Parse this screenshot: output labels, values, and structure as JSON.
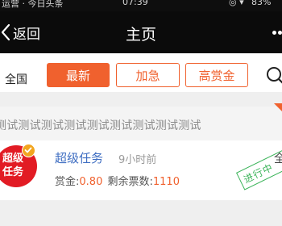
{
  "status_bar": {
    "left": "运营 · 今日头条",
    "time": "07:39",
    "battery": "83%"
  },
  "nav": {
    "back_label": "返回",
    "title": "主页"
  },
  "filter": {
    "region": "全国",
    "chips": [
      {
        "label": "最新",
        "active": true
      },
      {
        "label": "加急",
        "active": false
      },
      {
        "label": "高赏金",
        "active": false
      }
    ]
  },
  "marquee": {
    "text": "测试测试测试测试测试测试测试测试测试"
  },
  "task": {
    "badge_line1": "超级",
    "badge_line2": "任务",
    "title": "超级任务",
    "time": "9小时前",
    "reward_label": "赏金:",
    "reward_value": "0.80",
    "remaining_label": "剩余票数:",
    "remaining_value": "1110",
    "side_label": "全",
    "stamp": "进行中"
  },
  "colors": {
    "accent": "#f0612e",
    "nav_bg": "#0b0b0b",
    "badge_red": "#e21b24",
    "verify_gold": "#f2a51f",
    "title_blue": "#3f6ec2",
    "stamp_green": "#3cb45a"
  }
}
